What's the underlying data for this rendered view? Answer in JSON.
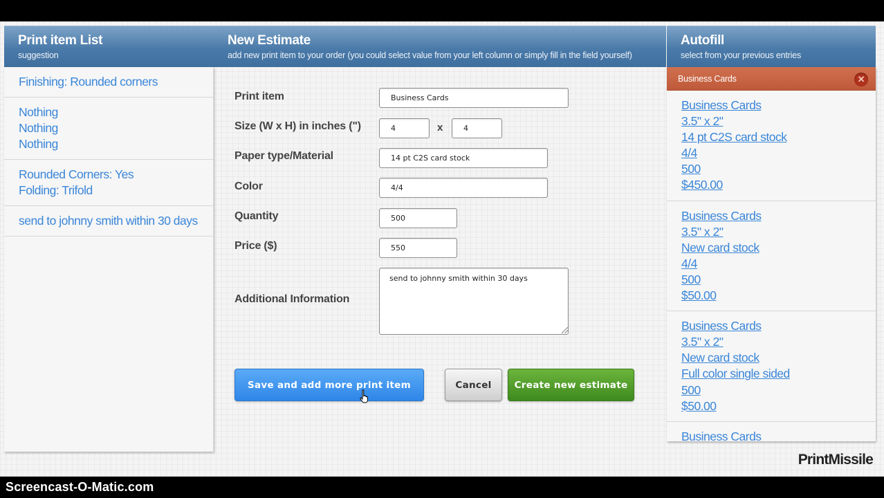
{
  "columns": {
    "left": {
      "title": "Print item List",
      "subtitle": "suggestion"
    },
    "middle": {
      "title": "New Estimate",
      "subtitle": "add new print item to your order (you could select value from your left column or simply fill in the field yourself)"
    },
    "right": {
      "title": "Autofill",
      "subtitle": "select from your previous entries"
    }
  },
  "suggestions": [
    [
      "Finishing: Rounded corners"
    ],
    [
      "Nothing",
      "Nothing",
      "Nothing"
    ],
    [
      "Rounded Corners: Yes",
      "Folding: Trifold"
    ],
    [
      "send to johnny smith within 30 days"
    ]
  ],
  "form": {
    "print_item": {
      "label": "Print item",
      "value": "Business Cards"
    },
    "size": {
      "label": "Size (W x H) in inches (\")",
      "width": "4",
      "height": "4",
      "separator": "x"
    },
    "paper": {
      "label": "Paper type/Material",
      "value": "14 pt C2S card stock"
    },
    "color": {
      "label": "Color",
      "value": "4/4"
    },
    "quantity": {
      "label": "Quantity",
      "value": "500"
    },
    "price": {
      "label": "Price ($)",
      "value": "550"
    },
    "info": {
      "label": "Additional Information",
      "value": "send to johnny smith within 30 days"
    }
  },
  "buttons": {
    "save": "Save and add more print item",
    "cancel": "Cancel",
    "create": "Create new estimate"
  },
  "autofill": {
    "selected": "Business Cards",
    "close": "✕",
    "entries": [
      [
        "Business Cards",
        "3.5\" x 2\"",
        "14 pt C2S card stock",
        "4/4",
        "500",
        "$450.00"
      ],
      [
        "Business Cards",
        "3.5\" x 2\"",
        "New card stock",
        "4/4",
        "500",
        "$50.00"
      ],
      [
        "Business Cards",
        "3.5\" x 2\"",
        "New card stock",
        "Full color single sided",
        "500",
        "$50.00"
      ],
      [
        "Business Cards"
      ]
    ]
  },
  "brand": "PrintMissile",
  "watermark": "Screencast-O-Matic.com",
  "colors": {
    "header_blue": "#4a7aa9",
    "link_blue": "#3a86d8",
    "selected_red": "#c8623f",
    "save_blue": "#2f86e8",
    "create_green": "#3f8a1e"
  }
}
